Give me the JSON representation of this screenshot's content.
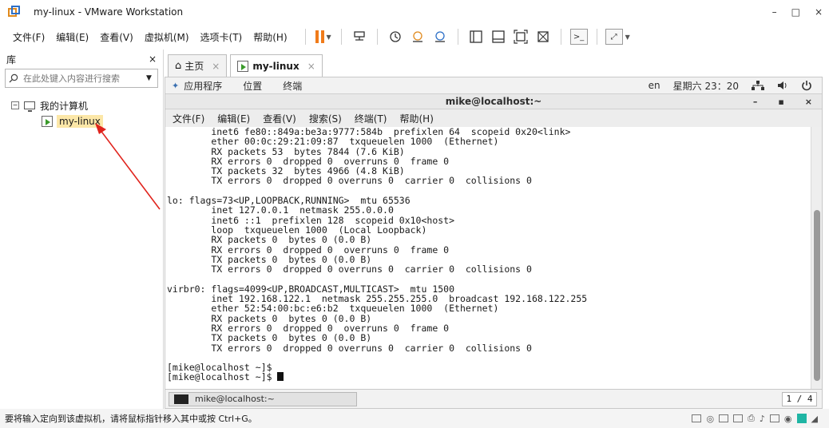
{
  "window": {
    "title": "my-linux - VMware Workstation",
    "controls": [
      "–",
      "□",
      "×"
    ]
  },
  "menubar": {
    "items": [
      "文件(F)",
      "编辑(E)",
      "查看(V)",
      "虚拟机(M)",
      "选项卡(T)",
      "帮助(H)"
    ]
  },
  "library": {
    "header": "库",
    "close": "×",
    "search_placeholder": "在此处键入内容进行搜索",
    "tree_root": "我的计算机",
    "tree_child": "my-linux"
  },
  "tabs": [
    {
      "label": "主页",
      "close": "×"
    },
    {
      "label": "my-linux",
      "close": "×"
    }
  ],
  "gnome": {
    "apps": "应用程序",
    "places": "位置",
    "terminal": "终端",
    "lang": "en",
    "clock": "星期六 23：20"
  },
  "terminal_window": {
    "title": "mike@localhost:~",
    "controls": [
      "–",
      "▪",
      "×"
    ],
    "menu": [
      "文件(F)",
      "编辑(E)",
      "查看(V)",
      "搜索(S)",
      "终端(T)",
      "帮助(H)"
    ],
    "lines": [
      "        inet6 fe80::849a:be3a:9777:584b  prefixlen 64  scopeid 0x20<link>",
      "        ether 00:0c:29:21:09:87  txqueuelen 1000  (Ethernet)",
      "        RX packets 53  bytes 7844 (7.6 KiB)",
      "        RX errors 0  dropped 0  overruns 0  frame 0",
      "        TX packets 32  bytes 4966 (4.8 KiB)",
      "        TX errors 0  dropped 0 overruns 0  carrier 0  collisions 0",
      "",
      "lo: flags=73<UP,LOOPBACK,RUNNING>  mtu 65536",
      "        inet 127.0.0.1  netmask 255.0.0.0",
      "        inet6 ::1  prefixlen 128  scopeid 0x10<host>",
      "        loop  txqueuelen 1000  (Local Loopback)",
      "        RX packets 0  bytes 0 (0.0 B)",
      "        RX errors 0  dropped 0  overruns 0  frame 0",
      "        TX packets 0  bytes 0 (0.0 B)",
      "        TX errors 0  dropped 0 overruns 0  carrier 0  collisions 0",
      "",
      "virbr0: flags=4099<UP,BROADCAST,MULTICAST>  mtu 1500",
      "        inet 192.168.122.1  netmask 255.255.255.0  broadcast 192.168.122.255",
      "        ether 52:54:00:bc:e6:b2  txqueuelen 1000  (Ethernet)",
      "        RX packets 0  bytes 0 (0.0 B)",
      "        RX errors 0  dropped 0  overruns 0  frame 0",
      "        TX packets 0  bytes 0 (0.0 B)",
      "        TX errors 0  dropped 0 overruns 0  carrier 0  collisions 0",
      "",
      "[mike@localhost ~]$",
      "[mike@localhost ~]$ "
    ]
  },
  "taskbar": {
    "item": "mike@localhost:~",
    "pager": "1 / 4"
  },
  "statusbar": {
    "message": "要将输入定向到该虚拟机，请将鼠标指针移入其中或按 Ctrl+G。"
  },
  "colors": {
    "accent_orange": "#f07b1a",
    "annotation_red": "#e0231c",
    "selection": "#fce7a8"
  }
}
